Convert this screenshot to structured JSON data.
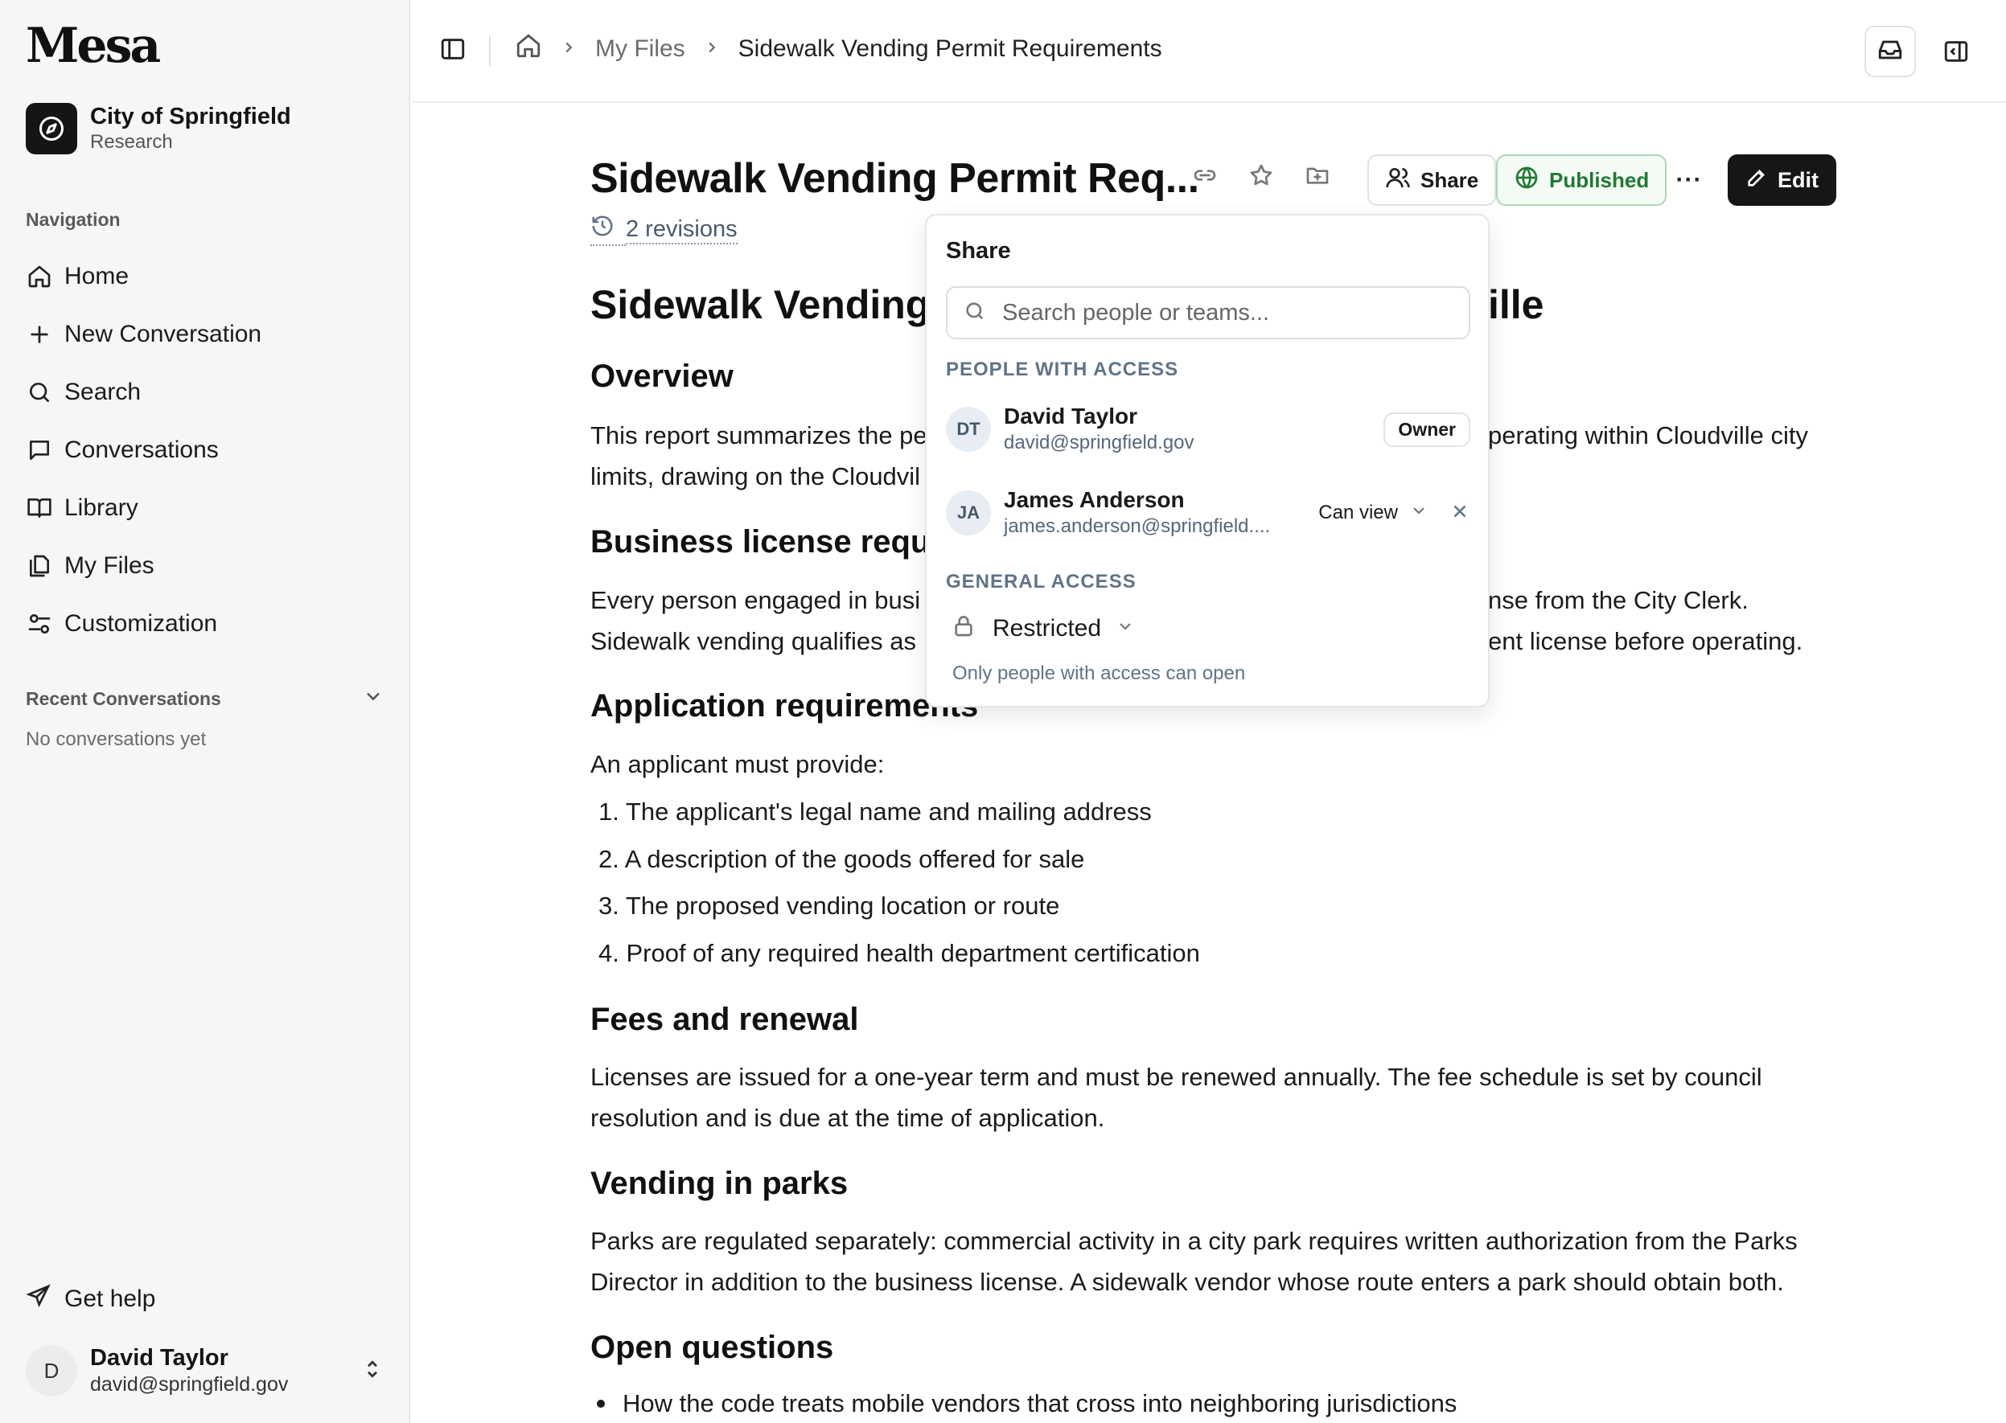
{
  "app": {
    "logo": "Mesa"
  },
  "org": {
    "name": "City of Springfield",
    "subtitle": "Research"
  },
  "sidebar": {
    "nav_heading": "Navigation",
    "items": [
      {
        "label": "Home",
        "icon": "home-icon"
      },
      {
        "label": "New Conversation",
        "icon": "plus-icon"
      },
      {
        "label": "Search",
        "icon": "search-icon"
      },
      {
        "label": "Conversations",
        "icon": "chat-icon"
      },
      {
        "label": "Library",
        "icon": "book-icon"
      },
      {
        "label": "My Files",
        "icon": "files-icon"
      },
      {
        "label": "Customization",
        "icon": "sliders-icon"
      }
    ],
    "recent_heading": "Recent Conversations",
    "recent_empty": "No conversations yet",
    "help": "Get help"
  },
  "user": {
    "initial": "D",
    "name": "David Taylor",
    "email": "david@springfield.gov"
  },
  "breadcrumb": {
    "parent": "My Files",
    "current": "Sidewalk Vending Permit Requirements"
  },
  "header": {
    "title": "Sidewalk Vending Permit Req...",
    "revisions": "2 revisions",
    "share_label": "Share",
    "published_label": "Published",
    "more_label": "···",
    "edit_label": "Edit"
  },
  "document": {
    "h1_left": "Sidewalk Vending",
    "h1_right": "ille",
    "overview_heading": "Overview",
    "overview_p1_left": "This report summarizes the pe",
    "overview_p1_right": "perating within Cloudville city",
    "overview_p2_left": "limits, drawing on the Cloudvil",
    "license_heading": "Business license requi",
    "license_p1_left": "Every person engaged in busi",
    "license_p1_right": "nse from the City Clerk.",
    "license_p2_left": "Sidewalk vending qualifies as",
    "license_p2_right": "ent license before operating.",
    "application_heading": "Application requirements",
    "application_intro": "An applicant must provide:",
    "application_items": [
      "1. The applicant's legal name and mailing address",
      "2. A description of the goods offered for sale",
      "3. The proposed vending location or route",
      "4. Proof of any required health department certification"
    ],
    "fees_heading": "Fees and renewal",
    "fees_p1": "Licenses are issued for a one-year term and must be renewed annually. The fee schedule is set by council",
    "fees_p2": "resolution and is due at the time of application.",
    "parks_heading": "Vending in parks",
    "parks_p1": "Parks are regulated separately: commercial activity in a city park requires written authorization from the Parks",
    "parks_p2": "Director in addition to the business license. A sidewalk vendor whose route enters a park should obtain both.",
    "questions_heading": "Open questions",
    "questions_items": [
      "How the code treats mobile vendors that cross into neighboring jurisdictions"
    ]
  },
  "share_popover": {
    "title": "Share",
    "search_placeholder": "Search people or teams...",
    "people_heading": "PEOPLE WITH ACCESS",
    "people": [
      {
        "initials": "DT",
        "name": "David Taylor",
        "email": "david@springfield.gov",
        "role": "Owner"
      },
      {
        "initials": "JA",
        "name": "James Anderson",
        "email": "james.anderson@springfield....",
        "role": "Can view"
      }
    ],
    "general_heading": "GENERAL ACCESS",
    "general_value": "Restricted",
    "general_hint": "Only people with access can open"
  },
  "colors": {
    "accent_dark": "#161616",
    "published_green": "#1f7a33",
    "muted_blue": "#5f7488"
  }
}
